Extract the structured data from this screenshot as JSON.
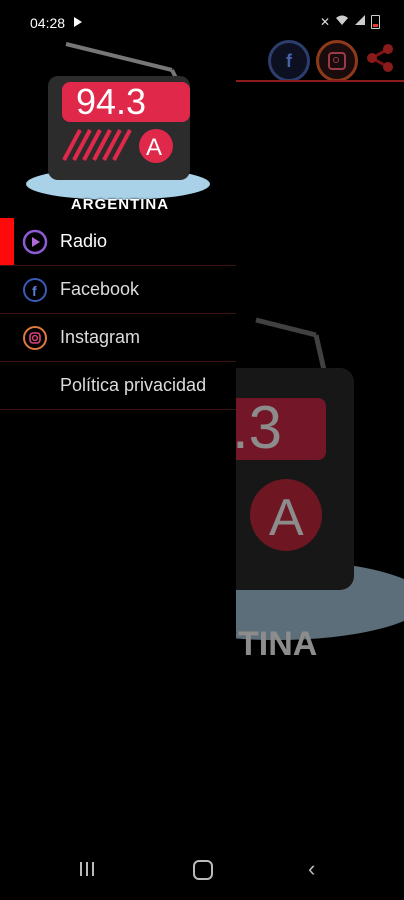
{
  "status_bar": {
    "time": "04:28",
    "icons": [
      "play-icon",
      "mute-icon",
      "wifi-icon",
      "signal-icon",
      "battery-low-icon"
    ]
  },
  "header": {
    "icons": [
      "facebook-icon",
      "instagram-icon",
      "share-icon"
    ]
  },
  "logo": {
    "frequency": "94.3",
    "band_letter": "A",
    "country": "ARGENTINA"
  },
  "background_logo": {
    "frequency_fragment": ".3",
    "band_letter": "A",
    "country_fragment": "TINA"
  },
  "menu": {
    "items": [
      {
        "label": "Radio",
        "icon": "radio-play-icon",
        "active": true
      },
      {
        "label": "Facebook",
        "icon": "facebook-icon",
        "active": false
      },
      {
        "label": "Instagram",
        "icon": "instagram-icon",
        "active": false
      },
      {
        "label": "Política privacidad",
        "icon": "",
        "active": false
      }
    ]
  },
  "colors": {
    "accent_red": "#ff0a0a",
    "logo_red": "#e0284a",
    "background": "#000000"
  }
}
